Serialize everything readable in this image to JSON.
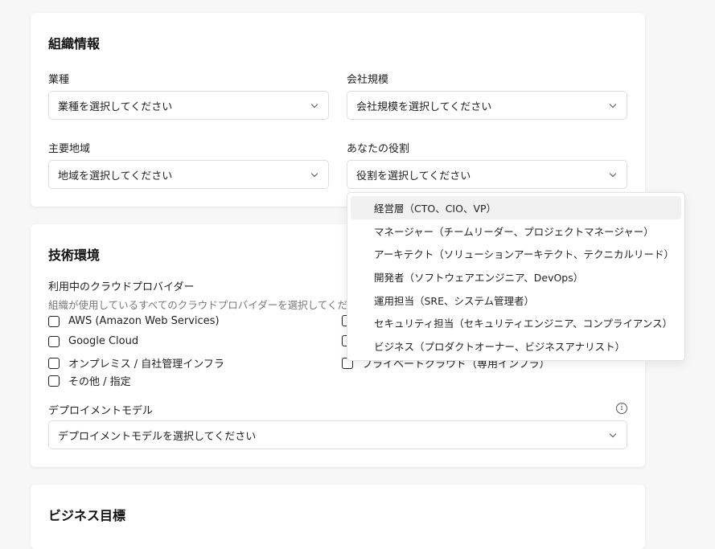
{
  "org": {
    "title": "組織情報",
    "industry_label": "業種",
    "industry_value": "業種を選択してください",
    "size_label": "会社規模",
    "size_value": "会社規模を選択してください",
    "region_label": "主要地域",
    "region_value": "地域を選択してください",
    "role_label": "あなたの役割",
    "role_value": "役割を選択してください"
  },
  "role_options": [
    "経営層（CTO、CIO、VP）",
    "マネージャー（チームリーダー、プロジェクトマネージャー）",
    "アーキテクト（ソリューションアーキテクト、テクニカルリード）",
    "開発者（ソフトウェアエンジニア、DevOps）",
    "運用担当（SRE、システム管理者）",
    "セキュリティ担当（セキュリティエンジニア、コンプライアンス）",
    "ビジネス（プロダクトオーナー、ビジネスアナリスト）"
  ],
  "tech": {
    "title": "技術環境",
    "cloud_label": "利用中のクラウドプロバイダー",
    "cloud_hint": "組織が使用しているすべてのクラウドプロバイダーを選択してください",
    "providers_left": [
      "AWS (Amazon Web Services)",
      "Google Cloud",
      "オンプレミス / 自社管理インフラ",
      "その他 / 指定"
    ],
    "providers_right_visible": "プライベートクラウド（専用インフラ）",
    "deploy_label": "デプロイメントモデル",
    "deploy_value": "デプロイメントモデルを選択してください",
    "info_icon": "info-icon"
  },
  "business": {
    "title": "ビジネス目標"
  }
}
